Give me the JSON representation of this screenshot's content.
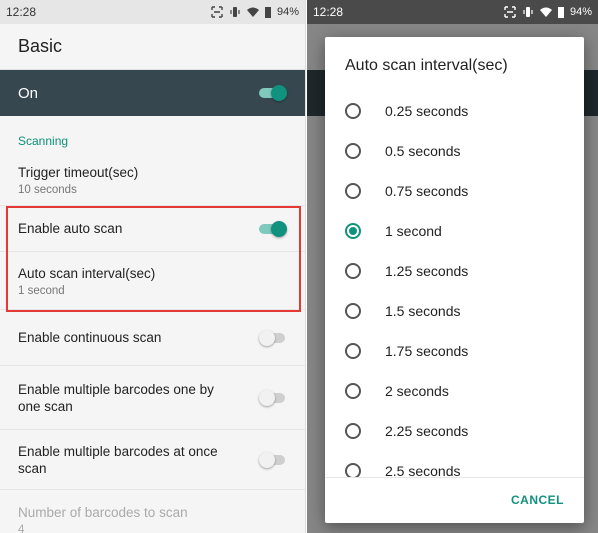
{
  "left": {
    "status": {
      "time": "12:28",
      "battery": "94%"
    },
    "title": "Basic",
    "master": {
      "label": "On",
      "on": true
    },
    "section": "Scanning",
    "items": [
      {
        "title": "Trigger timeout(sec)",
        "summary": "10 seconds"
      },
      {
        "title": "Enable auto scan",
        "toggle": true
      },
      {
        "title": "Auto scan interval(sec)",
        "summary": "1 second"
      },
      {
        "title": "Enable continuous scan",
        "toggle": false
      },
      {
        "title": "Enable multiple barcodes one by one scan",
        "toggle": false
      },
      {
        "title": "Enable multiple barcodes at once scan",
        "toggle": false
      },
      {
        "title": "Number of barcodes to scan",
        "summary": "4",
        "disabled": true
      }
    ]
  },
  "right": {
    "status": {
      "time": "12:28",
      "battery": "94%"
    },
    "dialog": {
      "title": "Auto scan interval(sec)",
      "options": [
        "0.25 seconds",
        "0.5 seconds",
        "0.75 seconds",
        "1 second",
        "1.25 seconds",
        "1.5 seconds",
        "1.75 seconds",
        "2 seconds",
        "2.25 seconds",
        "2.5 seconds"
      ],
      "selected": "1 second",
      "cancel": "CANCEL"
    }
  },
  "colors": {
    "accent": "#11927e",
    "header": "#37474f",
    "highlight": "#e53935"
  }
}
